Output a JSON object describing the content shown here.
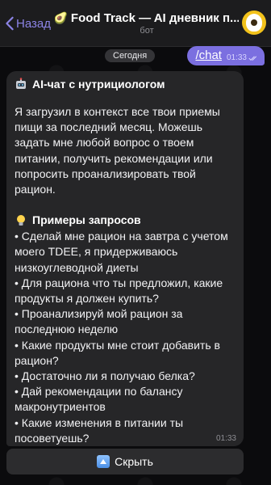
{
  "header": {
    "back_label": "Назад",
    "title": "Food Track — AI дневник п...",
    "subtitle": "бот",
    "title_emoji": "🥑"
  },
  "date_chip": "Сегодня",
  "outgoing": {
    "text": "/chat",
    "time": "01:33"
  },
  "incoming": {
    "heading": "AI-чат с нутрициологом",
    "intro": "Я загрузил в контекст все твои приемы пищи за последний месяц. Можешь задать мне любой вопрос о твоем питании, получить рекомендации или попросить проанализировать твой рацион.",
    "examples_heading": "Примеры запросов",
    "examples": [
      "• Сделай мне рацион на завтра с учетом моего TDEE, я придерживаюсь низкоуглеводной диеты",
      "• Для рациона что ты предложил, какие продукты я должен купить?",
      "• Проанализируй мой рацион за последнюю неделю",
      "• Какие продукты мне стоит добавить в рацион?",
      "• Достаточно ли я получаю белка?",
      "• Дай рекомендации по балансу макронутриентов",
      "• Какие изменения в питании ты посоветуешь?"
    ],
    "time": "01:33"
  },
  "hide_button": "Скрыть",
  "colors": {
    "accent": "#8c84e6",
    "outgoing_bubble": "#7b6fe0",
    "incoming_bubble": "#262628",
    "avatar": "#f2c21b"
  }
}
